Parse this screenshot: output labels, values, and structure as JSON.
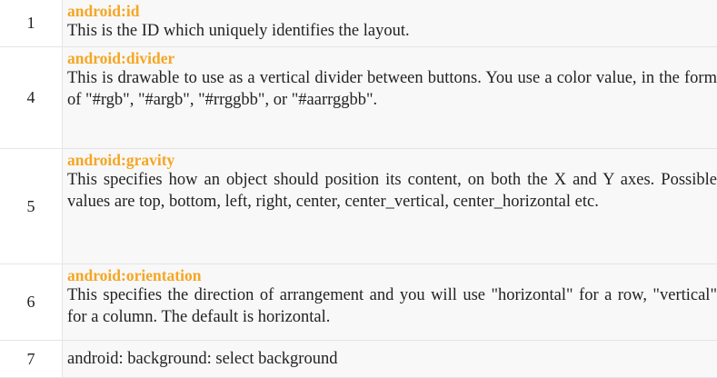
{
  "rows": [
    {
      "number": "1",
      "name": "android:id",
      "description": "This is the ID which uniquely identifies the layout."
    },
    {
      "number": "4",
      "name": "android:divider",
      "description": "This is drawable to use as a vertical divider between buttons. You use a color value, in the form of \"#rgb\", \"#argb\", \"#rrggbb\", or \"#aarrggbb\"."
    },
    {
      "number": "5",
      "name": "android:gravity",
      "description": "This specifies how an object should position its content, on both the X and Y axes. Possible values are top, bottom, left, right, center, center_vertical, center_horizontal etc."
    },
    {
      "number": "6",
      "name": "android:orientation",
      "description": "This specifies the direction of arrangement and you will use \"horizontal\" for a row, \"vertical\" for a column. The default is horizontal."
    },
    {
      "number": "7",
      "text": "android: background: select background"
    }
  ],
  "colors": {
    "attribute_name": "#f5a623",
    "cell_background": "#f8f8f8",
    "border": "#e5e5e5"
  }
}
